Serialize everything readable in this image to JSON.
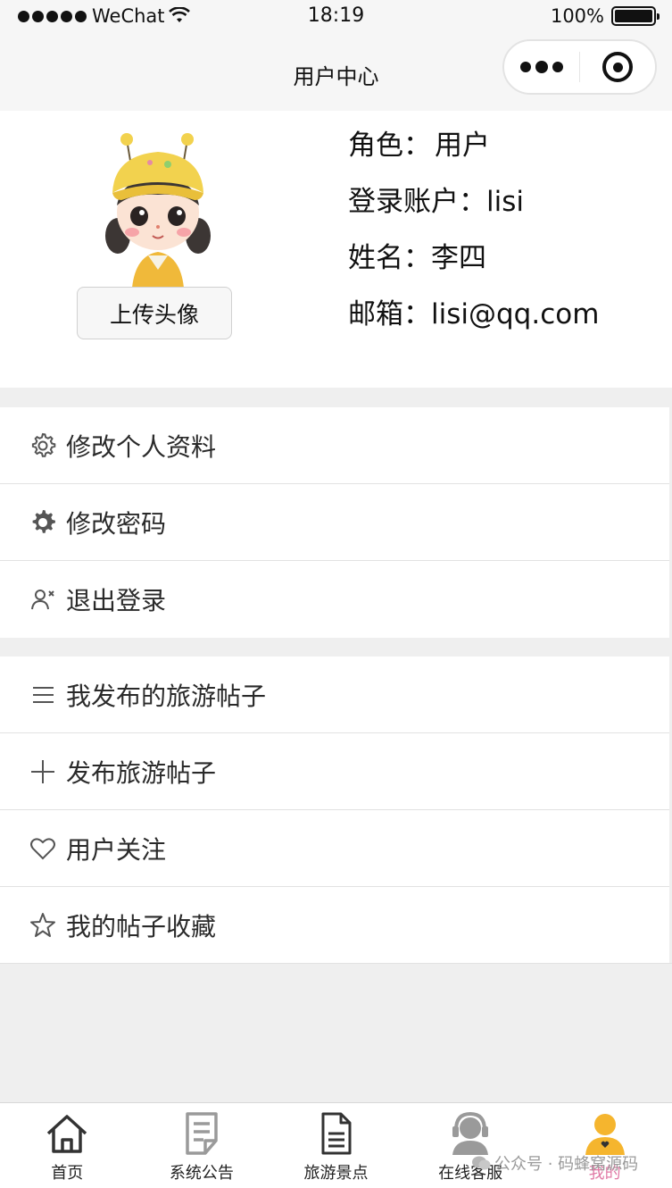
{
  "status_bar": {
    "carrier": "WeChat",
    "time": "18:19",
    "battery": "100%",
    "battery_level": 1.0
  },
  "nav": {
    "title": "用户中心"
  },
  "profile": {
    "upload_label": "上传头像",
    "role_label": "角色：",
    "role_value": "用户",
    "account_label": "登录账户：",
    "account_value": "lisi",
    "name_label": "姓名：",
    "name_value": "李四",
    "email_label": "邮箱：",
    "email_value": "lisi@qq.com"
  },
  "menu_section_1": {
    "items": [
      {
        "label": "修改个人资料",
        "icon": "gear-outline-icon"
      },
      {
        "label": "修改密码",
        "icon": "gear-filled-icon"
      },
      {
        "label": "退出登录",
        "icon": "user-remove-icon"
      }
    ]
  },
  "menu_section_2": {
    "items": [
      {
        "label": "我发布的旅游帖子",
        "icon": "list-icon"
      },
      {
        "label": "发布旅游帖子",
        "icon": "plus-icon"
      },
      {
        "label": "用户关注",
        "icon": "heart-icon"
      },
      {
        "label": "我的帖子收藏",
        "icon": "star-icon"
      }
    ]
  },
  "tab_bar": {
    "items": [
      {
        "label": "首页",
        "icon": "home-icon"
      },
      {
        "label": "系统公告",
        "icon": "notice-icon"
      },
      {
        "label": "旅游景点",
        "icon": "document-icon"
      },
      {
        "label": "在线客服",
        "icon": "support-icon"
      },
      {
        "label": "我的",
        "icon": "profile-icon",
        "active": true
      }
    ],
    "active_color": "#e07aa6"
  },
  "watermark": "公众号 · 码蜂窝源码"
}
